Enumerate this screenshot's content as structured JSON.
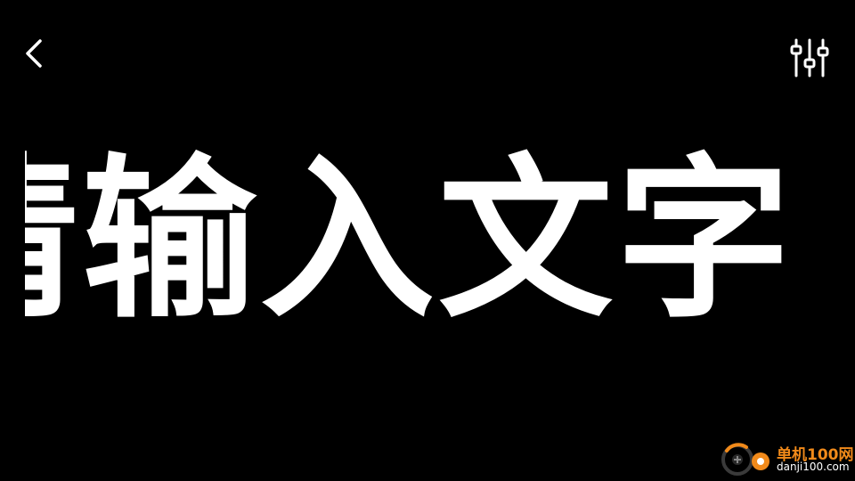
{
  "screen": {
    "marquee_text": "请输入文字",
    "text_color": "#ffffff",
    "background_color": "#000000"
  },
  "toolbar": {
    "back_icon": "chevron-left-icon",
    "settings_icon": "sliders-icon"
  },
  "watermark": {
    "name": "单机100网",
    "url": "danji100.com",
    "accent_color": "#f18a1a"
  }
}
